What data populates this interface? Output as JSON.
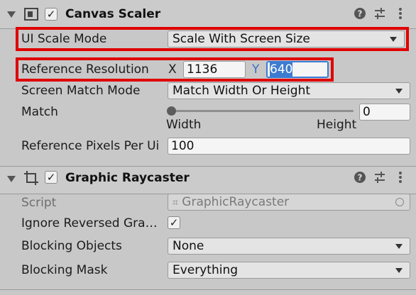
{
  "canvas_scaler": {
    "title": "Canvas Scaler",
    "enabled": true,
    "ui_scale_mode": {
      "label": "UI Scale Mode",
      "value": "Scale With Screen Size"
    },
    "reference_resolution": {
      "label": "Reference Resolution",
      "x_label": "X",
      "x_value": "1136",
      "y_label": "Y",
      "y_value": "640"
    },
    "screen_match_mode": {
      "label": "Screen Match Mode",
      "value": "Match Width Or Height"
    },
    "match": {
      "label": "Match",
      "value": "0",
      "slider_fraction": 0,
      "left_label": "Width",
      "right_label": "Height"
    },
    "reference_pixels_per_unit": {
      "label": "Reference Pixels Per Ui",
      "value": "100"
    }
  },
  "graphic_raycaster": {
    "title": "Graphic Raycaster",
    "enabled": true,
    "script": {
      "label": "Script",
      "value": "GraphicRaycaster"
    },
    "ignore_reversed_graphics": {
      "label": "Ignore Reversed Gra…",
      "checked": true
    },
    "blocking_objects": {
      "label": "Blocking Objects",
      "value": "None"
    },
    "blocking_mask": {
      "label": "Blocking Mask",
      "value": "Everything"
    }
  },
  "header_icons": [
    "help-icon",
    "presets-icon",
    "more-icon"
  ],
  "colors": {
    "highlight": "#e00000",
    "selection": "#3d7bd0"
  }
}
